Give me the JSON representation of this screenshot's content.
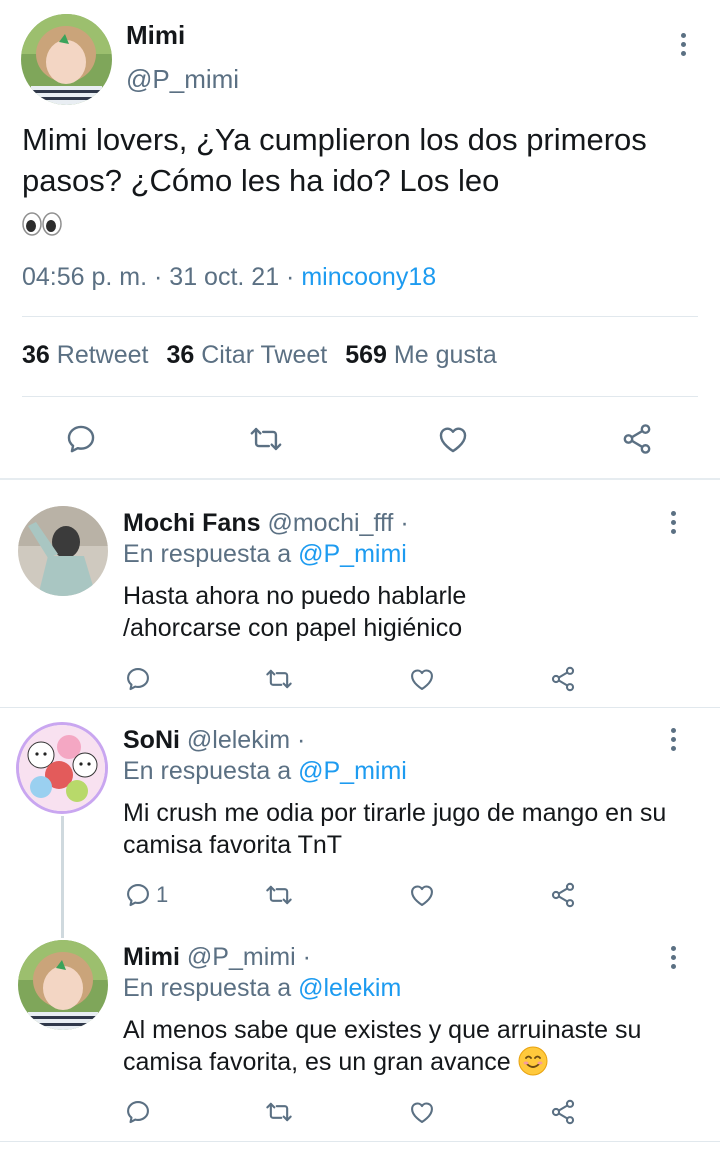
{
  "main_tweet": {
    "author_name": "Mimi",
    "author_handle": "@P_mimi",
    "text": "Mimi lovers, ¿Ya cumplieron los dos primeros pasos? ¿Cómo les ha ido? Los leo",
    "time": "04:56 p. m.",
    "sep1": " · ",
    "date": "31 oct. 21",
    "sep2": " · ",
    "via": "mincoony18",
    "stats": {
      "retweets_count": "36",
      "retweets_label": "Retweet",
      "quotes_count": "36",
      "quotes_label": "Citar Tweet",
      "likes_count": "569",
      "likes_label": "Me gusta"
    }
  },
  "replies": [
    {
      "name": "Mochi Fans",
      "handle": "@mochi_fff ·",
      "reply_prefix": "En respuesta a ",
      "reply_to": "@P_mimi",
      "text": "Hasta ahora no puedo hablarle /ahorcarse con papel higiénico",
      "reply_count": ""
    },
    {
      "name": "SoNi",
      "handle": "@lelekim ·",
      "reply_prefix": "En respuesta a ",
      "reply_to": "@P_mimi",
      "text": "Mi crush me odia por tirarle jugo de mango en su camisa favorita TnT",
      "reply_count": "1"
    },
    {
      "name": "Mimi",
      "handle": "@P_mimi ·",
      "reply_prefix": "En respuesta a ",
      "reply_to": "@lelekim",
      "text": "Al menos sabe que existes y que arruinaste su camisa favorita, es un gran avance",
      "reply_count": ""
    }
  ],
  "colors": {
    "accent": "#1d9bf0",
    "secondary_text": "#5b7083",
    "divider": "#e1e8ed"
  },
  "icons": {
    "reply": "reply-icon",
    "retweet": "retweet-icon",
    "like": "heart-icon",
    "share": "share-icon",
    "more": "more-vertical-icon"
  }
}
